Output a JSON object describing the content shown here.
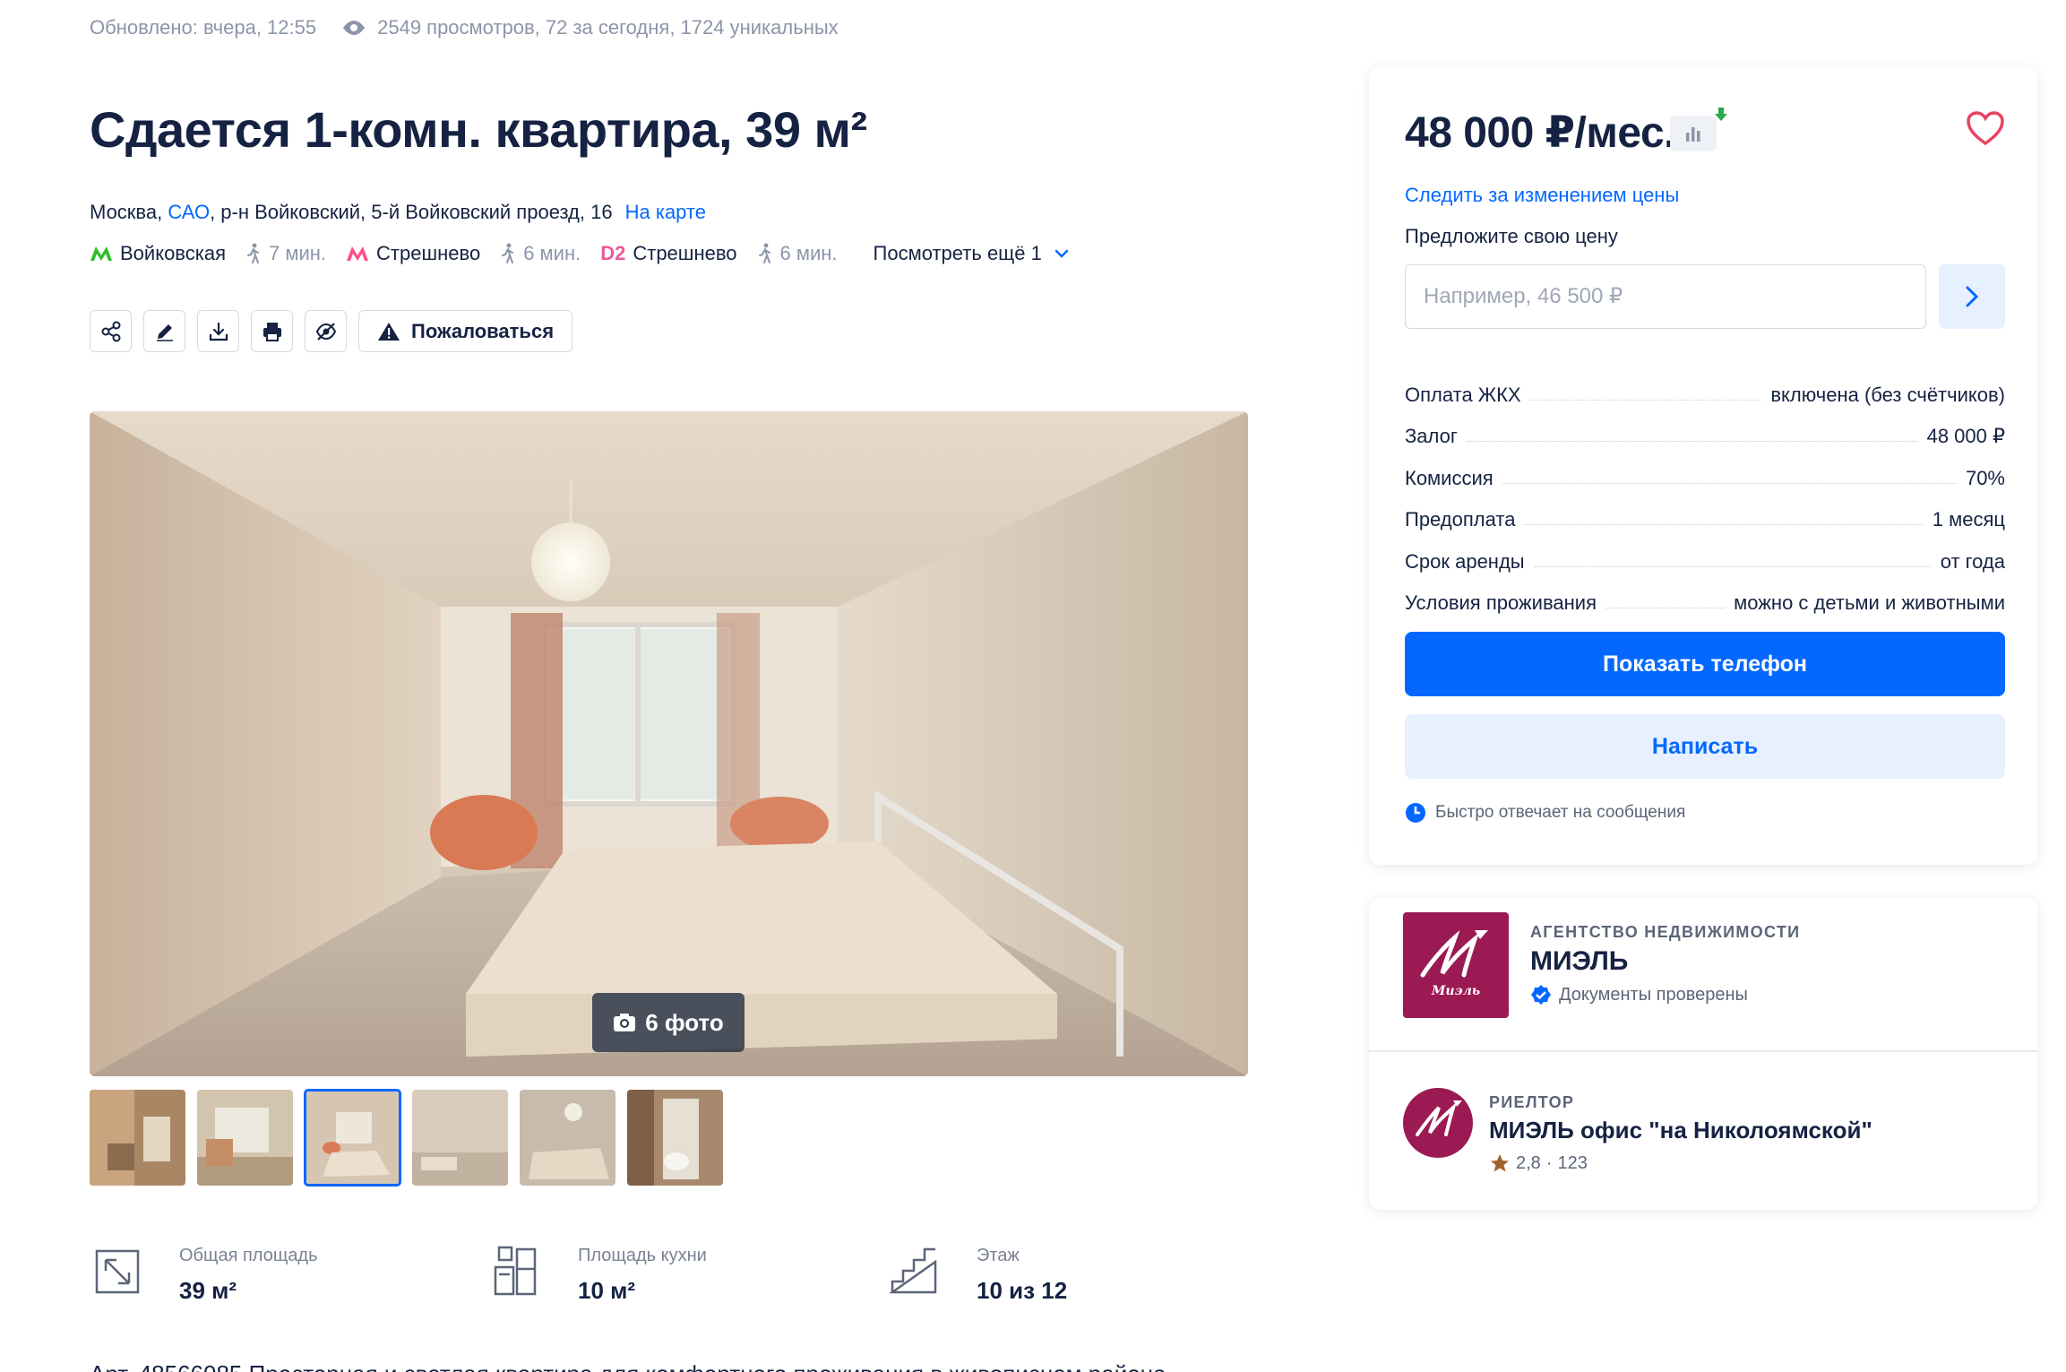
{
  "meta": {
    "updated": "Обновлено: вчера, 12:55",
    "views": "2549 просмотров, 72 за сегодня, 1724 уникальных"
  },
  "title": "Сдается 1-комн. квартира, 39 м²",
  "address": {
    "city": "Москва, ",
    "district_link": "САО",
    "rest": ", р-н Войковский, 5-й Войковский проезд, 16",
    "map_link": "На карте"
  },
  "metro": [
    {
      "logo": "M",
      "color": "#2dbe2c",
      "name": "Войковская",
      "walk": "7 мин."
    },
    {
      "logo": "M",
      "color": "#ff4f8e",
      "name": "Стрешнево",
      "walk": "6 мин."
    },
    {
      "logo": "D2",
      "color": "#e95b9c",
      "name": "Стрешнево",
      "walk": "6 мин."
    }
  ],
  "metro_more": "Посмотреть ещё 1",
  "toolbar": {
    "complain": "Пожаловаться",
    "icons": [
      "share-icon",
      "pencil-icon",
      "download-icon",
      "print-icon",
      "hide-icon"
    ]
  },
  "gallery": {
    "photo_count": "6 фото",
    "thumbnails": 6,
    "active_thumbnail": 3
  },
  "facts": [
    {
      "label": "Общая площадь",
      "value": "39 м²",
      "icon": "area-icon"
    },
    {
      "label": "Площадь кухни",
      "value": "10 м²",
      "icon": "kitchen-icon"
    },
    {
      "label": "Этаж",
      "value": "10 из 12",
      "icon": "stairs-icon"
    }
  ],
  "description_preview": "Арт. 48566085 Просторная и светлая квартира для комфортного проживания в живописном районе",
  "card": {
    "price": "48 000 ₽/мес.",
    "follow_price": "Следить за изменением цены",
    "offer_label": "Предложите свою цену",
    "offer_placeholder": "Например, 46 500 ₽",
    "terms": [
      {
        "key": "Оплата ЖКХ",
        "value": "включена (без счётчиков)"
      },
      {
        "key": "Залог",
        "value": "48 000 ₽"
      },
      {
        "key": "Комиссия",
        "value": "70%"
      },
      {
        "key": "Предоплата",
        "value": "1 месяц"
      },
      {
        "key": "Срок аренды",
        "value": "от года"
      },
      {
        "key": "Условия проживания",
        "value": "можно с детьми и животными"
      }
    ],
    "show_phone": "Показать телефон",
    "write": "Написать",
    "fast_reply": "Быстро отвечает на сообщения"
  },
  "agency": {
    "type": "АГЕНТСТВО НЕДВИЖИМОСТИ",
    "name": "МИЭЛЬ",
    "verified": "Документы проверены",
    "logo_text": "Миэль"
  },
  "realtor": {
    "type": "РИЕЛТОР",
    "name": "МИЭЛЬ офис \"на Николоямской\"",
    "rating": "2,8",
    "reviews": "123",
    "sep": "·"
  },
  "colors": {
    "accent": "#0468ff",
    "brand": "#9b1a54",
    "text": "#152242",
    "muted": "#8c95a8"
  }
}
